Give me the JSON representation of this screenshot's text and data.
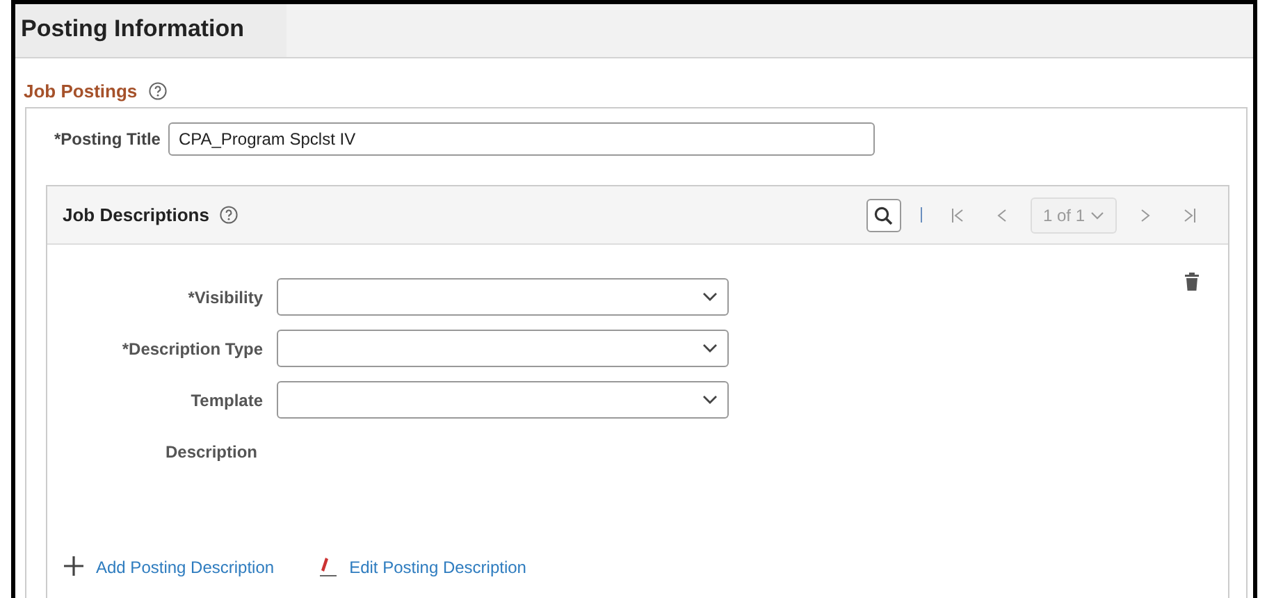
{
  "page_title": "Posting Information",
  "section": {
    "title": "Job Postings",
    "posting_title": {
      "label": "*Posting Title",
      "value": "CPA_Program Spclst IV"
    }
  },
  "job_descriptions": {
    "title": "Job Descriptions",
    "pager": "1 of 1",
    "fields": [
      {
        "label": "*Visibility",
        "kind": "select"
      },
      {
        "label": "*Description Type",
        "kind": "select"
      },
      {
        "label": "Template",
        "kind": "select"
      },
      {
        "label": "Description",
        "kind": "text"
      }
    ],
    "links": [
      {
        "label": "Add Posting Description",
        "kind": "add"
      },
      {
        "label": "Edit Posting Description",
        "kind": "edit"
      }
    ]
  }
}
